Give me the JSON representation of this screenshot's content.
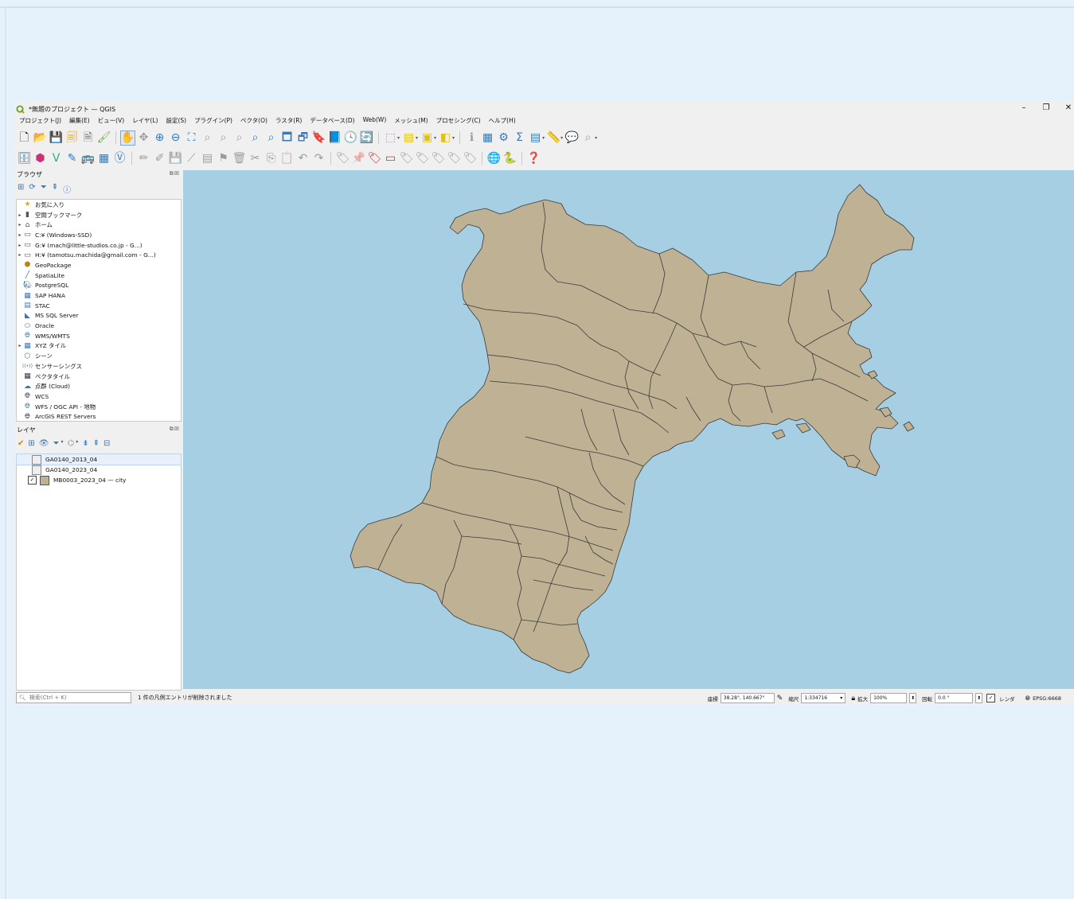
{
  "window": {
    "title": "*無題のプロジェクト — QGIS",
    "controls": [
      "–",
      "❐",
      "✕"
    ]
  },
  "menu": [
    "プロジェクト(J)",
    "編集(E)",
    "ビュー(V)",
    "レイヤ(L)",
    "設定(S)",
    "プラグイン(P)",
    "ベクタ(O)",
    "ラスタ(R)",
    "データベース(D)",
    "Web(W)",
    "メッシュ(M)",
    "プロセシング(C)",
    "ヘルプ(H)"
  ],
  "browser": {
    "title": "ブラウザ",
    "items": [
      {
        "label": "お気に入り",
        "icon": "star-icon",
        "arrow": ""
      },
      {
        "label": "空間ブックマーク",
        "icon": "bookmark-icon",
        "arrow": "▸"
      },
      {
        "label": "ホーム",
        "icon": "home-folder-icon",
        "arrow": "▸"
      },
      {
        "label": "C:¥ (Windows-SSD)",
        "icon": "drive-icon",
        "arrow": "▸"
      },
      {
        "label": "G:¥ (mach@little-studios.co.jp - G...)",
        "icon": "drive-icon",
        "arrow": "▸"
      },
      {
        "label": "H:¥ (tamotsu.machida@gmail.com - G...)",
        "icon": "drive-icon",
        "arrow": "▸"
      },
      {
        "label": "GeoPackage",
        "icon": "geopackage-icon",
        "arrow": ""
      },
      {
        "label": "SpatiaLite",
        "icon": "spatialite-icon",
        "arrow": ""
      },
      {
        "label": "PostgreSQL",
        "icon": "postgresql-icon",
        "arrow": ""
      },
      {
        "label": "SAP HANA",
        "icon": "sap-hana-icon",
        "arrow": ""
      },
      {
        "label": "STAC",
        "icon": "stac-icon",
        "arrow": ""
      },
      {
        "label": "MS SQL Server",
        "icon": "mssql-icon",
        "arrow": ""
      },
      {
        "label": "Oracle",
        "icon": "oracle-icon",
        "arrow": ""
      },
      {
        "label": "WMS/WMTS",
        "icon": "wms-icon",
        "arrow": ""
      },
      {
        "label": "XYZ タイル",
        "icon": "xyz-tiles-icon",
        "arrow": "▸"
      },
      {
        "label": "シーン",
        "icon": "scene-icon",
        "arrow": ""
      },
      {
        "label": "センサーシングス",
        "icon": "sensorthings-icon",
        "arrow": ""
      },
      {
        "label": "ベクタタイル",
        "icon": "vector-tile-icon",
        "arrow": ""
      },
      {
        "label": "点群 (Cloud)",
        "icon": "point-cloud-icon",
        "arrow": ""
      },
      {
        "label": "WCS",
        "icon": "wcs-icon",
        "arrow": ""
      },
      {
        "label": "WFS / OGC API - 地物",
        "icon": "wfs-icon",
        "arrow": ""
      },
      {
        "label": "ArcGIS REST Servers",
        "icon": "arcgis-icon",
        "arrow": ""
      }
    ]
  },
  "layers": {
    "title": "レイヤ",
    "items": [
      {
        "label": "GA0140_2013_04",
        "type": "table",
        "checked": false
      },
      {
        "label": "GA0140_2023_04",
        "type": "table",
        "checked": false
      },
      {
        "label": "MB0003_2023_04 — city",
        "type": "polygon",
        "checked": true
      }
    ]
  },
  "map": {
    "water_color": "#a6cfe4",
    "land_color": "#bfb294",
    "border_color": "#3a3a3a"
  },
  "status": {
    "search_placeholder": "検索(Ctrl + K)",
    "message": "1 件の凡例エントリが削除されました",
    "coord_label": "座標",
    "coord_value": "38.28°, 140.667°",
    "scale_label": "縮尺",
    "scale_value": "1:334716",
    "magnifier_label": "拡大",
    "magnifier_value": "100%",
    "rotation_label": "回転",
    "rotation_value": "0.0 °",
    "render_label": "レンダ",
    "crs": "EPSG:6668"
  }
}
